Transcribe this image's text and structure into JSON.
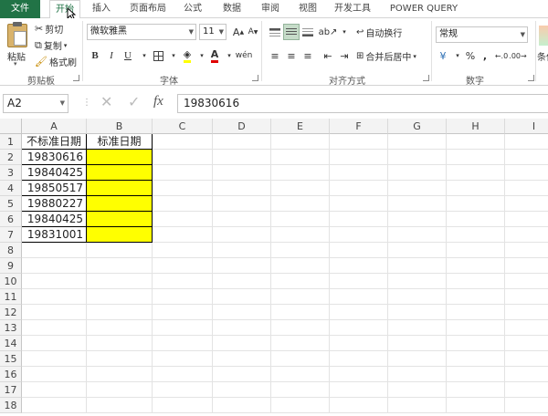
{
  "tabs": [
    "文件",
    "开始",
    "插入",
    "页面布局",
    "公式",
    "数据",
    "审阅",
    "视图",
    "开发工具",
    "POWER QUERY"
  ],
  "ribbon": {
    "clipboard": {
      "paste": "粘贴",
      "cut": "剪切",
      "copy": "复制",
      "format_painter": "格式刷",
      "label": "剪贴板"
    },
    "font": {
      "name": "微软雅黑",
      "size": "11",
      "bold": "B",
      "italic": "I",
      "underline": "U",
      "label": "字体"
    },
    "alignment": {
      "wrap": "自动换行",
      "merge": "合并后居中",
      "label": "对齐方式"
    },
    "number": {
      "format": "常规",
      "percent": "%",
      "comma": ",",
      "label": "数字"
    },
    "styles": {
      "conditional": "条件"
    }
  },
  "formula_bar": {
    "name_box": "A2",
    "fx": "fx",
    "value": "19830616"
  },
  "columns": [
    "A",
    "B",
    "C",
    "D",
    "E",
    "F",
    "G",
    "H",
    "I"
  ],
  "rows": [
    "1",
    "2",
    "3",
    "4",
    "5",
    "6",
    "7",
    "8",
    "9",
    "10",
    "11",
    "12",
    "13",
    "14",
    "15",
    "16",
    "17",
    "18"
  ],
  "cells": {
    "A1": "不标准日期",
    "B1": "标准日期",
    "A2": "19830616",
    "A3": "19840425",
    "A4": "19850517",
    "A5": "19880227",
    "A6": "19840425",
    "A7": "19831001"
  },
  "colors": {
    "file_tab": "#217346",
    "highlight": "#ffff00"
  }
}
